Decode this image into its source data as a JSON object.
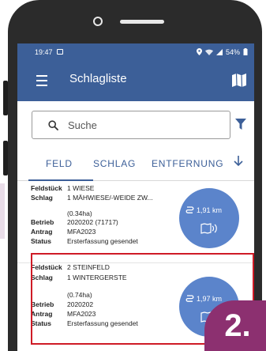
{
  "statusbar": {
    "time": "19:47",
    "battery": "54%"
  },
  "header": {
    "title": "Schlagliste"
  },
  "search": {
    "placeholder": "Suche"
  },
  "tabs": [
    {
      "label": "FELD"
    },
    {
      "label": "SCHLAG"
    },
    {
      "label": "ENTFERNUNG"
    }
  ],
  "labels": {
    "feldstueck": "Feldstück",
    "schlag": "Schlag",
    "betrieb": "Betrieb",
    "antrag": "Antrag",
    "status": "Status"
  },
  "items": [
    {
      "feldstueck": "1  WIESE",
      "schlag": "1  MÄHWIESE/-WEIDE ZW...",
      "area": "(0.34ha)",
      "betrieb": "2020202 (71717)",
      "antrag": "MFA2023",
      "status": "Ersterfassung gesendet",
      "distance": "1,91 km"
    },
    {
      "feldstueck": "2  STEINFELD",
      "schlag": "1  WINTERGERSTE",
      "area": "(0.74ha)",
      "betrieb": "2020202",
      "antrag": "MFA2023",
      "status": "Ersterfassung gesendet",
      "distance": "1,97 km"
    }
  ],
  "step": {
    "label": "2."
  },
  "colors": {
    "primary": "#3c5f98",
    "distance_circle": "#5b84cb",
    "highlight": "#cf1b26",
    "badge": "#8c3070"
  }
}
